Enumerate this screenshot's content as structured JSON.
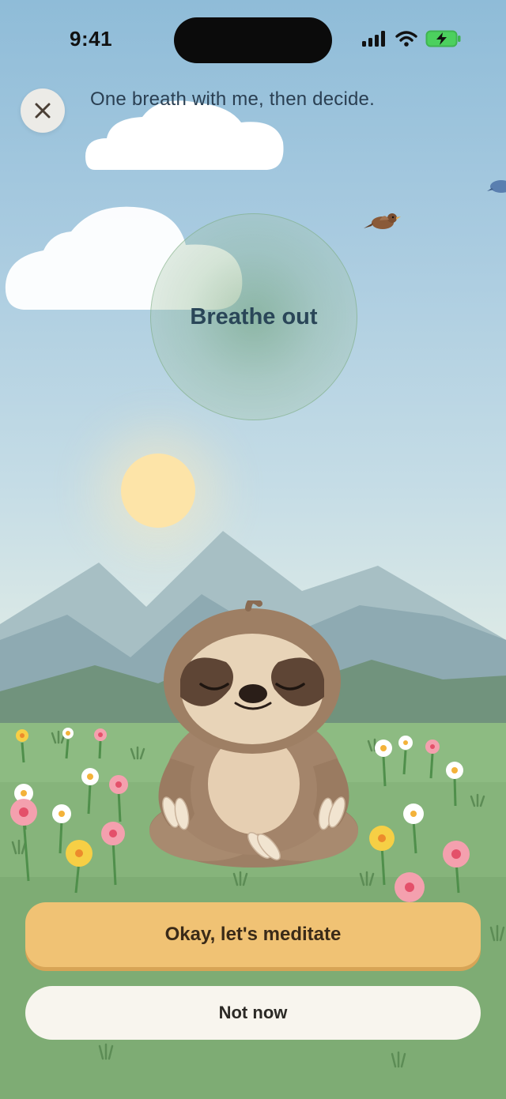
{
  "status_bar": {
    "time": "9:41",
    "icons": [
      "signal-icon",
      "wifi-icon",
      "battery-charging-icon"
    ]
  },
  "header": {
    "close_icon": "close-icon",
    "prompt": "One breath with me, then decide."
  },
  "breath": {
    "label": "Breathe out"
  },
  "actions": {
    "primary": "Okay, let's meditate",
    "secondary": "Not now"
  },
  "colors": {
    "primary_button": "#f0c274",
    "secondary_button": "#f8f5ee",
    "sky_top": "#8fbcd8",
    "meadow": "#8dbb82"
  }
}
